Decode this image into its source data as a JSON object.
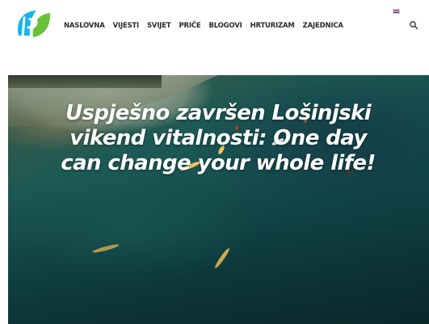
{
  "header": {
    "logo_icon": "lp-leaf-logo-icon",
    "brand_colors": [
      "#18b5e8",
      "#6ac23a"
    ],
    "nav": [
      {
        "label": "NASLOVNA"
      },
      {
        "label": "VIJESTI"
      },
      {
        "label": "SVIJET"
      },
      {
        "label": "PRIČE"
      },
      {
        "label": "BLOGOVI"
      },
      {
        "label": "HRTURIZAM"
      },
      {
        "label": "ZAJEDNICA"
      }
    ],
    "language": {
      "icon": "croatian-flag-icon"
    },
    "search_icon": "search-icon"
  },
  "hero": {
    "category": "",
    "headline": "Uspješno završen Lošinjski vikend vitalnosti: One day can change your whole life!"
  }
}
